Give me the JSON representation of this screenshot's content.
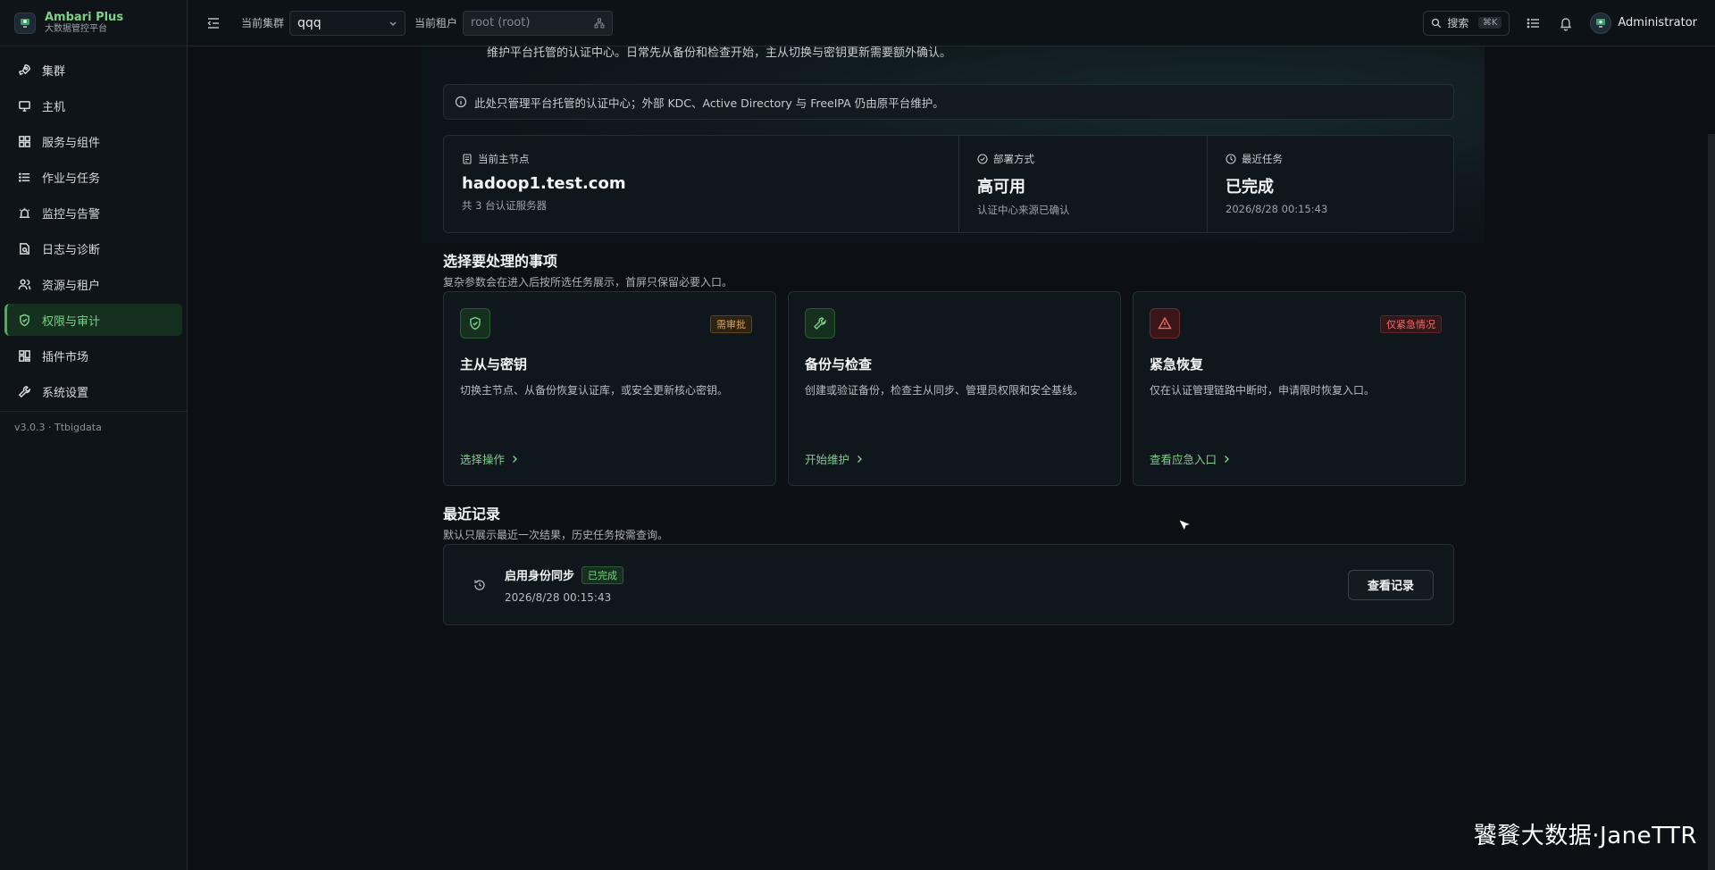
{
  "brand": {
    "title": "Ambari Plus",
    "subtitle": "大数据管控平台"
  },
  "sidebar": {
    "items": [
      {
        "label": "集群",
        "icon": "rocket-icon"
      },
      {
        "label": "主机",
        "icon": "monitor-icon"
      },
      {
        "label": "服务与组件",
        "icon": "grid-icon"
      },
      {
        "label": "作业与任务",
        "icon": "list-icon"
      },
      {
        "label": "监控与告警",
        "icon": "siren-icon"
      },
      {
        "label": "日志与诊断",
        "icon": "log-search-icon"
      },
      {
        "label": "资源与租户",
        "icon": "users-icon"
      },
      {
        "label": "权限与审计",
        "icon": "shield-icon",
        "active": true
      },
      {
        "label": "插件市场",
        "icon": "plugin-icon"
      },
      {
        "label": "系统设置",
        "icon": "wrench-icon"
      }
    ],
    "version": "v3.0.3 · Ttbigdata"
  },
  "topbar": {
    "cluster_label": "当前集群",
    "cluster_value": "qqq",
    "tenant_label": "当前租户",
    "tenant_value": "root (root)",
    "search_label": "搜索",
    "search_shortcut": "⌘K",
    "user_name": "Administrator"
  },
  "main": {
    "hero_desc": "维护平台托管的认证中心。日常先从备份和检查开始，主从切换与密钥更新需要额外确认。",
    "notice": "此处只管理平台托管的认证中心；外部 KDC、Active Directory 与 FreeIPA 仍由原平台维护。",
    "stats": [
      {
        "label": "当前主节点",
        "value": "hadoop1.test.com",
        "sub": "共 3 台认证服务器",
        "icon": "server-icon"
      },
      {
        "label": "部署方式",
        "value": "高可用",
        "sub": "认证中心来源已确认",
        "icon": "check-circle-icon"
      },
      {
        "label": "最近任务",
        "value": "已完成",
        "sub": "2026/8/28 00:15:43",
        "icon": "clock-icon"
      }
    ],
    "tasks_title": "选择要处理的事项",
    "tasks_sub": "复杂参数会在进入后按所选任务展示，首屏只保留必要入口。",
    "cards": [
      {
        "title": "主从与密钥",
        "desc": "切换主节点、从备份恢复认证库，或安全更新核心密钥。",
        "link": "选择操作",
        "badge": "需审批",
        "tone": "amber",
        "icon": "shield-check-icon"
      },
      {
        "title": "备份与检查",
        "desc": "创建或验证备份，检查主从同步、管理员权限和安全基线。",
        "link": "开始维护",
        "badge": "",
        "tone": "green",
        "icon": "wrench-icon"
      },
      {
        "title": "紧急恢复",
        "desc": "仅在认证管理链路中断时，申请限时恢复入口。",
        "link": "查看应急入口",
        "badge": "仅紧急情况",
        "tone": "red",
        "icon": "warning-icon"
      }
    ],
    "records_title": "最近记录",
    "records_sub": "默认只展示最近一次结果，历史任务按需查询。",
    "record": {
      "name": "启用身份同步",
      "status": "已完成",
      "time": "2026/8/28 00:15:43",
      "button": "查看记录"
    }
  },
  "watermark": "饕餮大数据·JaneTTR",
  "colors": {
    "accent": "#7cd08a",
    "amber": "#e0a14a",
    "danger": "#ef6b6b",
    "background": "#0c1015"
  }
}
